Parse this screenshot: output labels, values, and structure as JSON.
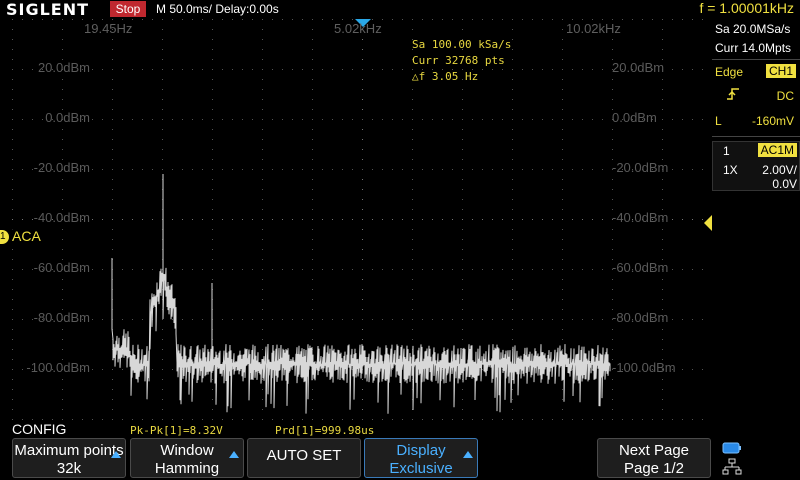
{
  "header": {
    "brand": "SIGLENT",
    "run_state": "Stop",
    "timebase": "M 50.0ms/ Delay:0.00s",
    "trigger_freq": "f = 1.00001kHz"
  },
  "display": {
    "freq_labels": [
      "19.45Hz",
      "5.02kHz",
      "10.02kHz"
    ],
    "dbm_left": [
      "20.0dBm",
      "0.0dBm",
      "-20.0dBm",
      "-40.0dBm",
      "-60.0dBm",
      "-80.0dBm",
      "-100.0dBm"
    ],
    "dbm_right": [
      "20.0dBm",
      "0.0dBm",
      "-20.0dBm",
      "-40.0dBm",
      "-60.0dBm",
      "-80.0dBm",
      "-100.0dBm"
    ],
    "info": {
      "sample_rate": "Sa 100.00 kSa/s",
      "points": "Curr 32768 pts",
      "delta_f": "△f 3.05 Hz"
    },
    "channel_marker": "1",
    "channel_label": "ACA",
    "trace_color": "#d8d8d8",
    "accent_color": "#f0e040"
  },
  "right_panel": {
    "acq_rate": "Sa 20.0MSa/s",
    "acq_pts": "Curr 14.0Mpts",
    "trigger_type": "Edge",
    "trigger_source": "CH1",
    "coupling": "DC",
    "level_label": "L",
    "level_value": "-160mV",
    "ch_number": "1",
    "ch_coupling": "AC1M",
    "probe": "1X",
    "vdiv": "2.00V/",
    "offset": "0.0V"
  },
  "status": {
    "menu_name": "CONFIG",
    "pkpk": "Pk-Pk[1]=8.32V",
    "period": "Prd[1]=999.98us"
  },
  "softkeys": [
    {
      "line1": "Maximum points",
      "line2": "32k"
    },
    {
      "line1": "Window",
      "line2": "Hamming"
    },
    {
      "line1": "AUTO SET",
      "line2": ""
    },
    {
      "line1": "Display",
      "line2": "Exclusive"
    },
    {
      "line1": "Next Page",
      "line2": "Page 1/2"
    }
  ]
}
